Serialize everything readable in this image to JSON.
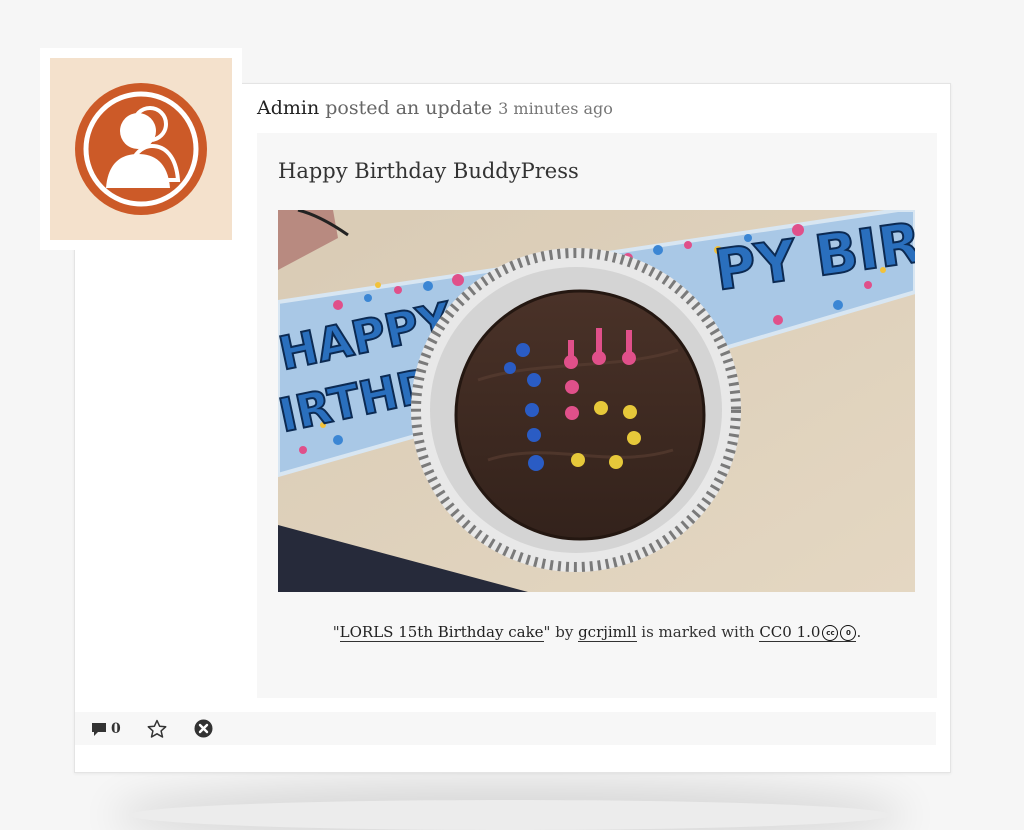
{
  "activity": {
    "user": "Admin",
    "action": "posted an update",
    "time": "3 minutes ago",
    "title": "Happy Birthday BuddyPress",
    "image_icon": "birthday-cake-photo",
    "banner_text": "HAPPY BIRTHDAY"
  },
  "credit": {
    "open_quote": "\"",
    "work_title": "LORLS 15th Birthday cake",
    "by_text": "\" by ",
    "author": "gcrjimll",
    "marked_text": " is marked with ",
    "license": "CC0 1.0",
    "period": "."
  },
  "actions": {
    "comment_count": "0",
    "comment_icon": "comment-icon",
    "favorite_icon": "star-icon",
    "delete_icon": "close-circle-icon"
  },
  "colors": {
    "avatar_bg": "#f4e1cc",
    "avatar_fg": "#cc5a28"
  }
}
